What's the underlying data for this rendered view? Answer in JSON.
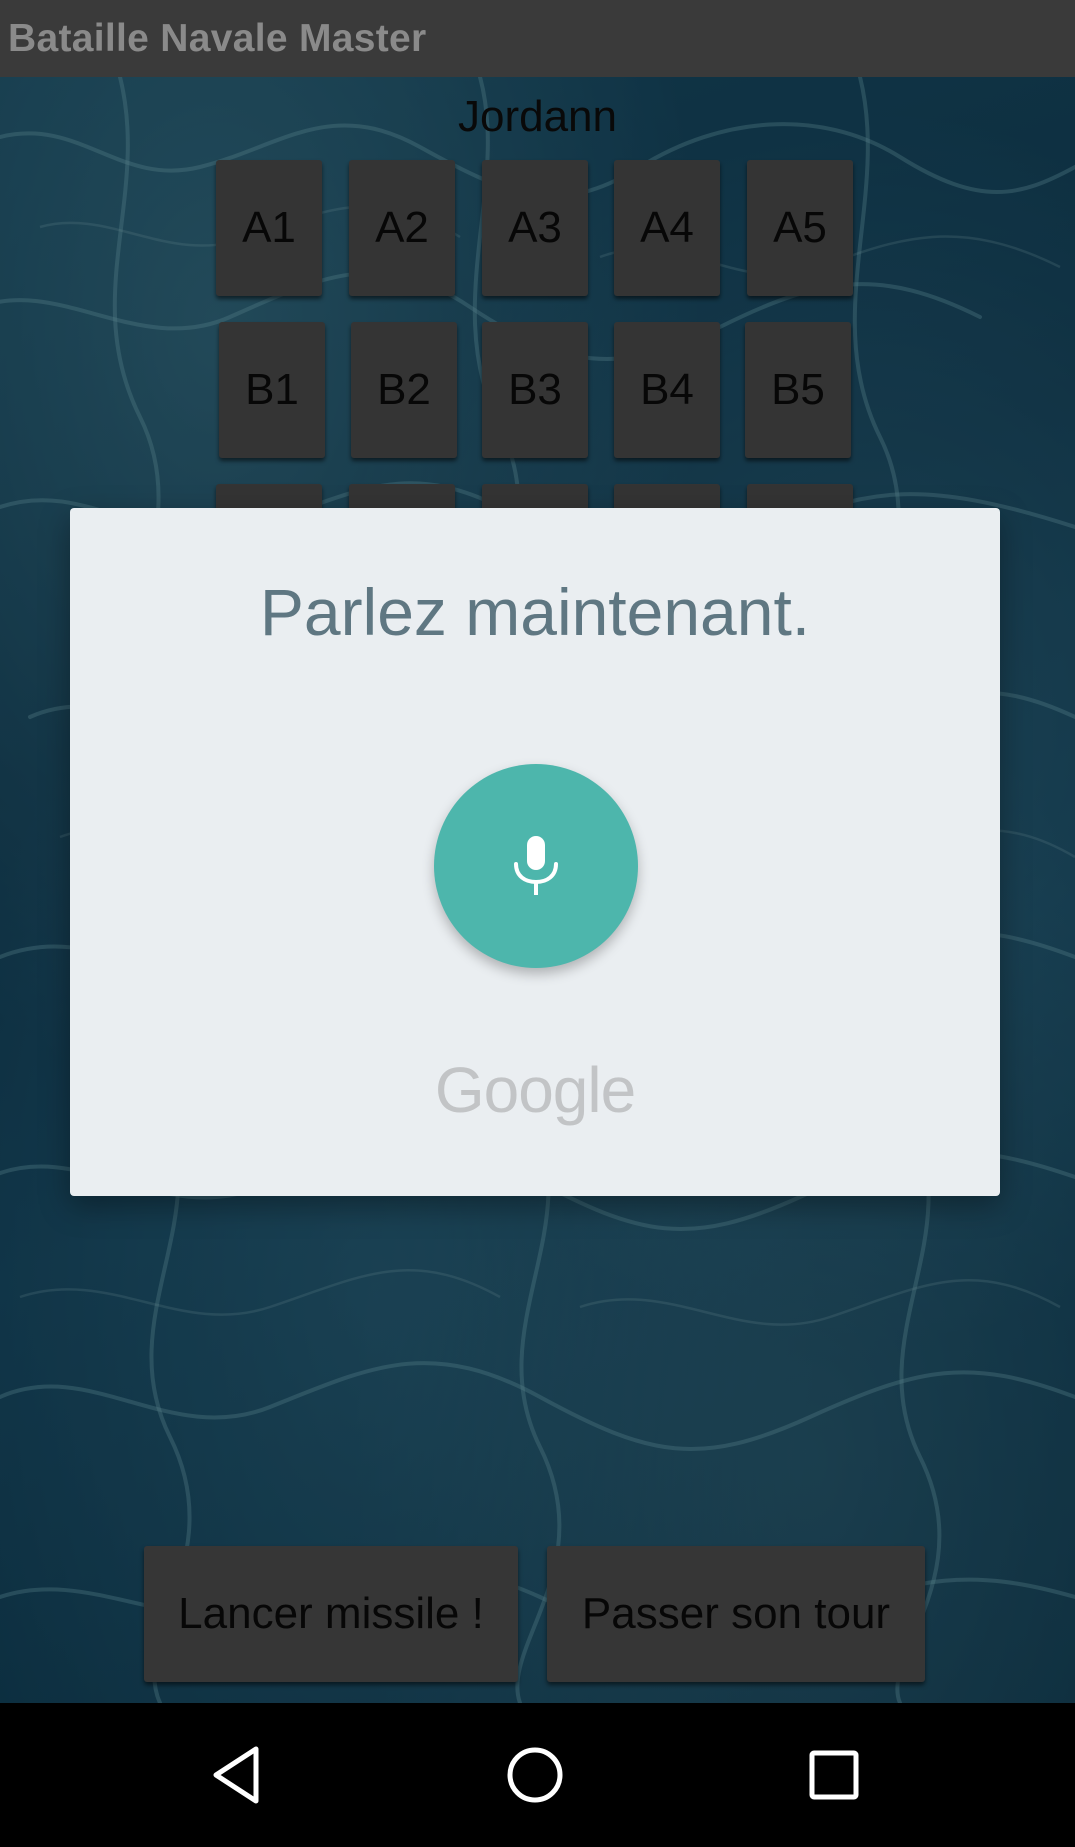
{
  "app": {
    "title": "Bataille Navale Master"
  },
  "player": {
    "name": "Jordann"
  },
  "grid": {
    "row_a": [
      "A1",
      "A2",
      "A3",
      "A4",
      "A5"
    ],
    "row_b": [
      "B1",
      "B2",
      "B3",
      "B4",
      "B5"
    ]
  },
  "actions": {
    "launch_label": "Lancer missile !",
    "pass_label": "Passer son tour"
  },
  "voice_dialog": {
    "prompt": "Parlez maintenant.",
    "brand": "Google",
    "mic_color": "#4db6ac"
  },
  "nav": {
    "back_icon": "back-triangle-icon",
    "home_icon": "home-circle-icon",
    "recents_icon": "recents-square-icon"
  }
}
